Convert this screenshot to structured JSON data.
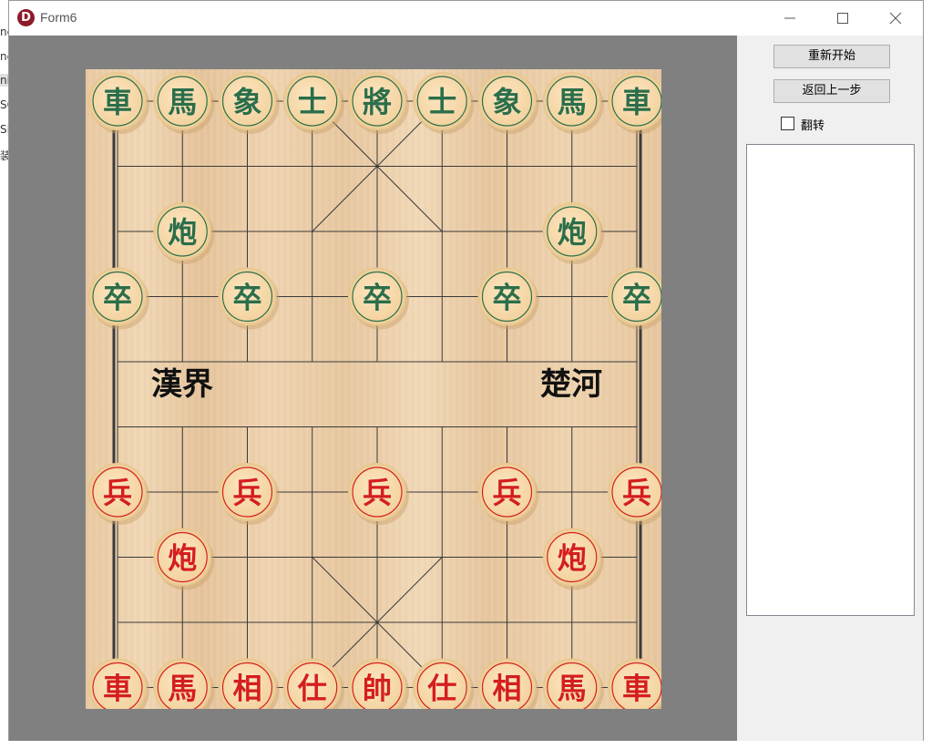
{
  "window": {
    "title": "Form6",
    "icon_letter": "D"
  },
  "background_window": {
    "fragments": [
      "ne",
      "ne",
      "ni",
      "SC",
      "SP",
      "装"
    ]
  },
  "controls": {
    "restart_label": "重新开始",
    "undo_label": "返回上一步",
    "flip_label": "翻转",
    "flip_checked": false
  },
  "river": {
    "left_text": "漢界",
    "right_text": "楚河"
  },
  "colors": {
    "black_piece": "#2b6e4a",
    "red_piece": "#d41e1e",
    "board_line": "#3a3a3a"
  },
  "pieces": [
    {
      "side": "black",
      "char": "車",
      "col": 0,
      "row": 0
    },
    {
      "side": "black",
      "char": "馬",
      "col": 1,
      "row": 0
    },
    {
      "side": "black",
      "char": "象",
      "col": 2,
      "row": 0
    },
    {
      "side": "black",
      "char": "士",
      "col": 3,
      "row": 0
    },
    {
      "side": "black",
      "char": "將",
      "col": 4,
      "row": 0
    },
    {
      "side": "black",
      "char": "士",
      "col": 5,
      "row": 0
    },
    {
      "side": "black",
      "char": "象",
      "col": 6,
      "row": 0
    },
    {
      "side": "black",
      "char": "馬",
      "col": 7,
      "row": 0
    },
    {
      "side": "black",
      "char": "車",
      "col": 8,
      "row": 0
    },
    {
      "side": "black",
      "char": "炮",
      "col": 1,
      "row": 2
    },
    {
      "side": "black",
      "char": "炮",
      "col": 7,
      "row": 2
    },
    {
      "side": "black",
      "char": "卒",
      "col": 0,
      "row": 3
    },
    {
      "side": "black",
      "char": "卒",
      "col": 2,
      "row": 3
    },
    {
      "side": "black",
      "char": "卒",
      "col": 4,
      "row": 3
    },
    {
      "side": "black",
      "char": "卒",
      "col": 6,
      "row": 3
    },
    {
      "side": "black",
      "char": "卒",
      "col": 8,
      "row": 3
    },
    {
      "side": "red",
      "char": "兵",
      "col": 0,
      "row": 6
    },
    {
      "side": "red",
      "char": "兵",
      "col": 2,
      "row": 6
    },
    {
      "side": "red",
      "char": "兵",
      "col": 4,
      "row": 6
    },
    {
      "side": "red",
      "char": "兵",
      "col": 6,
      "row": 6
    },
    {
      "side": "red",
      "char": "兵",
      "col": 8,
      "row": 6
    },
    {
      "side": "red",
      "char": "炮",
      "col": 1,
      "row": 7
    },
    {
      "side": "red",
      "char": "炮",
      "col": 7,
      "row": 7
    },
    {
      "side": "red",
      "char": "車",
      "col": 0,
      "row": 9
    },
    {
      "side": "red",
      "char": "馬",
      "col": 1,
      "row": 9
    },
    {
      "side": "red",
      "char": "相",
      "col": 2,
      "row": 9
    },
    {
      "side": "red",
      "char": "仕",
      "col": 3,
      "row": 9
    },
    {
      "side": "red",
      "char": "帥",
      "col": 4,
      "row": 9
    },
    {
      "side": "red",
      "char": "仕",
      "col": 5,
      "row": 9
    },
    {
      "side": "red",
      "char": "相",
      "col": 6,
      "row": 9
    },
    {
      "side": "red",
      "char": "馬",
      "col": 7,
      "row": 9
    },
    {
      "side": "red",
      "char": "車",
      "col": 8,
      "row": 9
    }
  ]
}
